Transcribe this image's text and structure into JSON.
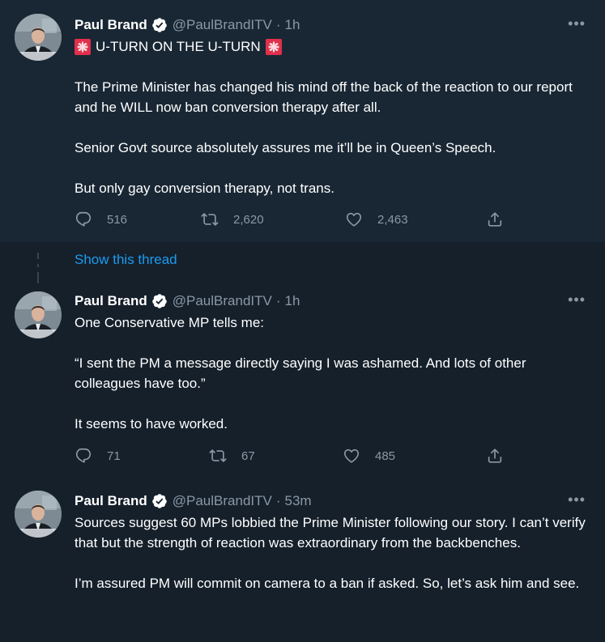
{
  "tweets": [
    {
      "author": {
        "name": "Paul Brand",
        "handle": "@PaulBrandITV"
      },
      "time": "1h",
      "more": "•••",
      "title_emoji": "rotating-light",
      "paragraphs": [
        "U-TURN ON THE U-TURN",
        "The Prime Minister has changed his mind off the back of the reaction to our report and he WILL now ban conversion therapy after all.",
        "Senior Govt source absolutely assures me it’ll be in Queen’s Speech.",
        "But only gay conversion therapy, not trans."
      ],
      "stats": {
        "replies": "516",
        "retweets": "2,620",
        "likes": "2,463"
      }
    },
    {
      "author": {
        "name": "Paul Brand",
        "handle": "@PaulBrandITV"
      },
      "time": "1h",
      "more": "•••",
      "paragraphs": [
        "One Conservative MP tells me:",
        "“I sent the PM a message directly saying I was ashamed. And lots of other colleagues have too.”",
        "It seems to have worked."
      ],
      "stats": {
        "replies": "71",
        "retweets": "67",
        "likes": "485"
      }
    },
    {
      "author": {
        "name": "Paul Brand",
        "handle": "@PaulBrandITV"
      },
      "time": "53m",
      "more": "•••",
      "paragraphs": [
        "Sources suggest 60 MPs lobbied the Prime Minister following our story. I can’t verify that but the strength of reaction was extraordinary from the backbenches.",
        "I’m assured PM will commit on camera to a ban if asked. So, let’s ask him and see."
      ]
    }
  ],
  "show_thread": "Show this thread",
  "colors": {
    "background": "#15202b",
    "highlight": "#192734",
    "accent": "#1d9bf0",
    "muted": "#8b98a5"
  }
}
